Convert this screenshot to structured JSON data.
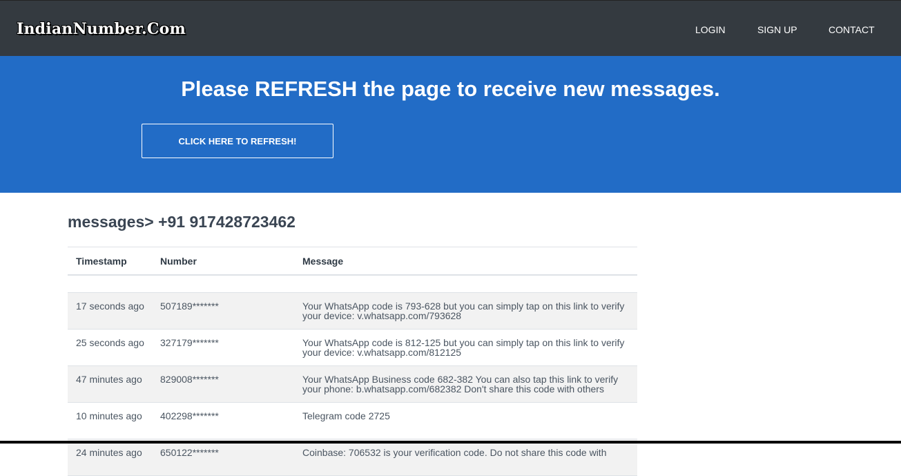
{
  "nav": {
    "brand": "IndianNumber.Com",
    "links": [
      "LOGIN",
      "SIGN UP",
      "CONTACT"
    ]
  },
  "hero": {
    "title": "Please REFRESH the page to receive new messages.",
    "button": "CLICK HERE TO REFRESH!"
  },
  "messages": {
    "heading": "messages> +91 917428723462",
    "columns": [
      "Timestamp",
      "Number",
      "Message"
    ],
    "rows": [
      {
        "time": "17 seconds ago",
        "number": "507189*******",
        "message": "Your WhatsApp code is 793-628 but you can simply tap on this link to verify your device: v.whatsapp.com/793628"
      },
      {
        "time": "25 seconds ago",
        "number": "327179*******",
        "message": "Your WhatsApp code is 812-125 but you can simply tap on this link to verify your device: v.whatsapp.com/812125"
      },
      {
        "time": "47 minutes ago",
        "number": "829008*******",
        "message": "Your WhatsApp Business code 682-382 You can also tap this link to verify your phone: b.whatsapp.com/682382 Don't share this code with others"
      },
      {
        "time": "10 minutes ago",
        "number": "402298*******",
        "message": "Telegram code 2725"
      },
      {
        "time": "24 minutes ago",
        "number": "650122*******",
        "message": "Coinbase: 706532 is your verification code. Do not share this code with"
      }
    ]
  }
}
